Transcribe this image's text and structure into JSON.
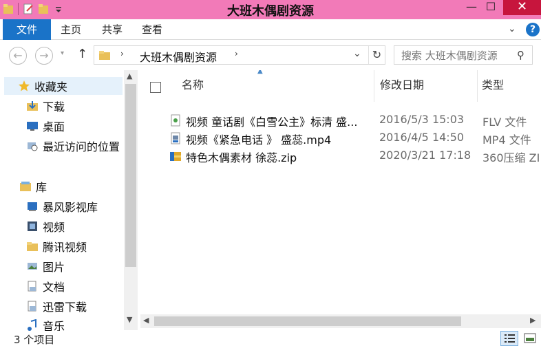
{
  "window": {
    "title": "大班木偶剧资源",
    "min_glyph": "—",
    "max_glyph": "☐",
    "close_glyph": "✕",
    "icons": [
      "folder-icon",
      "properties-icon",
      "new-folder-icon",
      "quick-access-dropdown-icon"
    ]
  },
  "ribbon": {
    "tabs": [
      "文件",
      "主页",
      "共享",
      "查看"
    ],
    "file_tab_color": "#1a73c8",
    "collapse_glyph": "⌄",
    "help_label": "?"
  },
  "navbar": {
    "back_glyph": "←",
    "forward_glyph": "→",
    "history_glyph": "▾",
    "up_glyph": "↑",
    "breadcrumb_sep": "›",
    "address": "大班木偶剧资源",
    "address_dropdown_glyph": "⌄",
    "refresh_glyph": "↻",
    "search_placeholder": "搜索 大班木偶剧资源",
    "search_glyph": "⚲"
  },
  "nav_pane": {
    "items": [
      {
        "label": "收藏夹",
        "icon": "star-icon"
      },
      {
        "label": "下载",
        "icon": "downloads-folder-icon"
      },
      {
        "label": "桌面",
        "icon": "desktop-icon"
      },
      {
        "label": "最近访问的位置",
        "icon": "recent-places-icon"
      },
      {
        "label": "库",
        "icon": "libraries-icon"
      },
      {
        "label": "暴风影视库",
        "icon": "library-icon"
      },
      {
        "label": "视频",
        "icon": "videos-icon"
      },
      {
        "label": "腾讯视频",
        "icon": "folder-icon"
      },
      {
        "label": "图片",
        "icon": "pictures-icon"
      },
      {
        "label": "文档",
        "icon": "documents-icon"
      },
      {
        "label": "迅雷下载",
        "icon": "library-icon"
      },
      {
        "label": "音乐",
        "icon": "music-icon"
      }
    ]
  },
  "scrollbars": {
    "up": "▲",
    "down": "▼",
    "left": "◀",
    "right": "▶"
  },
  "file_list": {
    "columns": {
      "name": "名称",
      "date": "修改日期",
      "type": "类型"
    },
    "sort_glyph": "▲",
    "rows": [
      {
        "name": "视频 童话剧《白雪公主》标清 盛...",
        "date": "2016/5/3 15:03",
        "type": "FLV 文件",
        "icon": "flv-file-icon"
      },
      {
        "name": "视频《紧急电话 》 盛蕊.mp4",
        "date": "2016/4/5 14:50",
        "type": "MP4 文件",
        "icon": "mp4-file-icon"
      },
      {
        "name": "特色木偶素材 徐蕊.zip",
        "date": "2020/3/21 17:18",
        "type": "360压缩 ZI",
        "icon": "zip-archive-icon"
      }
    ]
  },
  "status": {
    "count": "3 个项目"
  },
  "colors": {
    "titlebar": "#f27ab8",
    "close": "#c7153d",
    "accent": "#1a73c8"
  }
}
